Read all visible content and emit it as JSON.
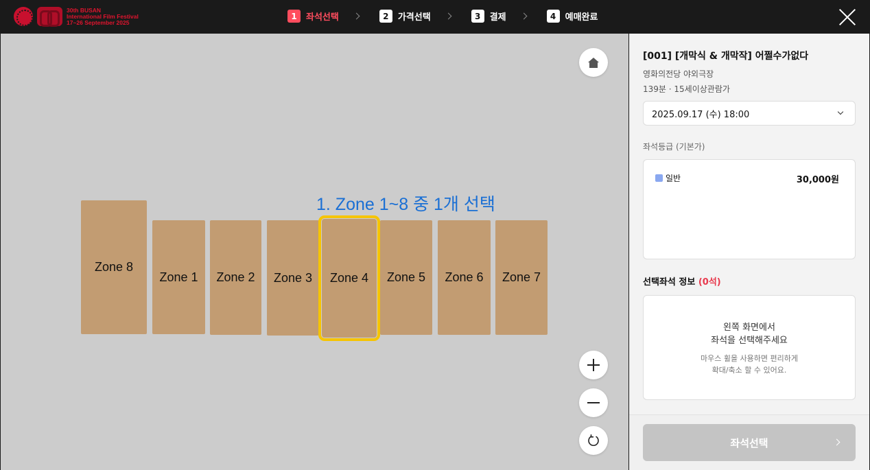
{
  "logo": {
    "line1": "30th BUSAN",
    "line2": "International Film Festival",
    "line3": "17~26 September 2025",
    "brand_color": "#e0142e"
  },
  "steps": [
    {
      "num": "1",
      "label": "좌석선택",
      "active": true
    },
    {
      "num": "2",
      "label": "가격선택",
      "active": false
    },
    {
      "num": "3",
      "label": "결제",
      "active": false
    },
    {
      "num": "4",
      "label": "예매완료",
      "active": false
    }
  ],
  "map": {
    "instruction": "1. Zone 1~8 중 1개 선택",
    "instruction_color": "#1a6fd4",
    "background_color": "#cccccc",
    "zone_color": "#c29c72",
    "selected_outline_color": "#f6c400",
    "zones": [
      "Zone 8",
      "Zone 1",
      "Zone 2",
      "Zone 3",
      "Zone 4",
      "Zone 5",
      "Zone 6",
      "Zone 7"
    ],
    "selected_zone": "Zone 4",
    "controls": [
      "home-icon",
      "zoom-in-icon",
      "zoom-out-icon",
      "refresh-icon"
    ]
  },
  "sidebar": {
    "movie_title": "[001] [개막식 & 개막작] 어쩔수가없다",
    "venue": "영화의전당 야외극장",
    "runtime": "139분 · 15세이상관람가",
    "date": "2025.09.17 (수) 18:00",
    "grade_label": "좌석등급 (기본가)",
    "grade": {
      "name": "일반",
      "price": "30,000원",
      "color": "#8aa8f0"
    },
    "selected_label": "선택좌석 정보",
    "selected_count": "(0석)",
    "selected_count_color": "#e8394d",
    "empty_line1": "왼쪽 화면에서",
    "empty_line2": "좌석을 선택해주세요",
    "hint_line1": "마우스 휠을 사용하면 편리하게",
    "hint_line2": "확대/축소 할 수 있어요.",
    "submit_label": "좌석선택"
  }
}
